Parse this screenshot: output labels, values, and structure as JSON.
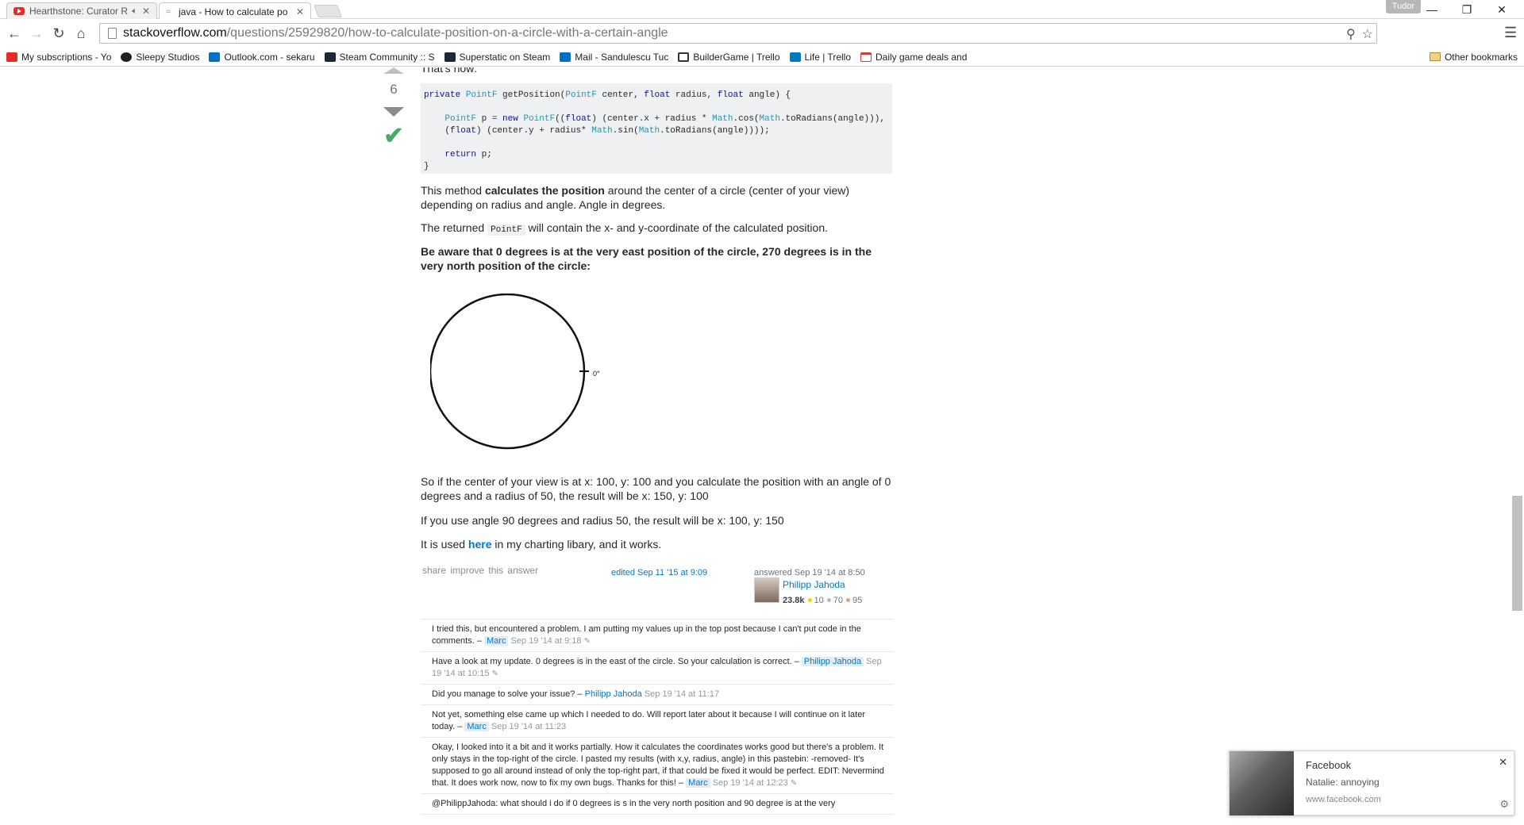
{
  "browser": {
    "tabs": [
      {
        "title": "Hearthstone: Curator R",
        "active": false
      },
      {
        "title": "java - How to calculate po",
        "active": true
      }
    ],
    "profile_name": "Tudor",
    "url_host": "stackoverflow.com",
    "url_path": "/questions/25929820/how-to-calculate-position-on-a-circle-with-a-certain-angle",
    "bookmarks": [
      {
        "label": "My subscriptions - Yo",
        "icon": "youtube-icon",
        "color": "#e52d27"
      },
      {
        "label": "Sleepy Studios",
        "icon": "sleepy-icon",
        "color": "#222222"
      },
      {
        "label": "Outlook.com - sekaru",
        "icon": "outlook-icon",
        "color": "#0072c6"
      },
      {
        "label": "Steam Community :: S",
        "icon": "steam-icon",
        "color": "#1b2838"
      },
      {
        "label": "Superstatic on Steam",
        "icon": "steam-icon",
        "color": "#1b2838"
      },
      {
        "label": "Mail - Sandulescu Tuc",
        "icon": "mail-icon",
        "color": "#0072c6"
      },
      {
        "label": "BuilderGame | Trello",
        "icon": "trello-icon",
        "color": "#0079bf"
      },
      {
        "label": "Life | Trello",
        "icon": "trello-icon",
        "color": "#0079bf"
      },
      {
        "label": "Daily game deals and",
        "icon": "calendar-icon",
        "color": "#d23f31"
      }
    ],
    "other_bookmarks": "Other bookmarks"
  },
  "answer": {
    "cut_text": "That's how:",
    "score": "6",
    "code_lines": [
      "private PointF getPosition(PointF center, float radius, float angle) {",
      "",
      "    PointF p = new PointF((float) (center.x + radius * Math.cos(Math.toRadians(angle))),",
      "    (float) (center.y + radius* Math.sin(Math.toRadians(angle))));",
      "",
      "    return p;",
      "}"
    ],
    "para1_a": "This method ",
    "para1_bold": "calculates the position",
    "para1_b": " around the center of a circle (center of your view) depending on radius and angle. Angle in degrees.",
    "para2_a": "The returned ",
    "para2_code": "PointF",
    "para2_b": " will contain the x- and y-coordinate of the calculated position.",
    "para3": "Be aware that 0 degrees is at the very east position of the circle, 270 degrees is in the very north position of the circle:",
    "circle_label": "0°",
    "para4": "So if the center of your view is at x: 100, y: 100 and you calculate the position with an angle of 0 degrees and a radius of 50, the result will be x: 150, y: 100",
    "para5": "If you use angle 90 degrees and radius 50, the result will be x: 100, y: 150",
    "para6_a": "It is used ",
    "para6_link": "here",
    "para6_b": " in my charting libary, and it works.",
    "menu_share": "share",
    "menu_improve": "improve this answer",
    "edited": "edited Sep 11 '15 at 9:09",
    "answered": "answered Sep 19 '14 at 8:50",
    "user_name": "Philipp Jahoda",
    "user_rep": "23.8k",
    "badge_gold": "10",
    "badge_silver": "70",
    "badge_bronze": "95"
  },
  "comments": [
    {
      "text": "I tried this, but encountered a problem. I am putting my values up in the top post because I can't put code in the comments. – ",
      "user": "Marc",
      "highlight": true,
      "date": "Sep 19 '14 at 9:18",
      "edited": true
    },
    {
      "text": "Have a look at my update. 0 degrees is in the east of the circle. So your calculation is correct. – ",
      "user": "Philipp Jahoda",
      "highlight": true,
      "date": "Sep 19 '14 at 10:15",
      "edited": true
    },
    {
      "text": "Did you manage to solve your issue? – ",
      "user": "Philipp Jahoda",
      "highlight": false,
      "date": "Sep 19 '14 at 11:17",
      "edited": false
    },
    {
      "text": "Not yet, something else came up which I needed to do. Will report later about it because I will continue on it later today. – ",
      "user": "Marc",
      "highlight": true,
      "date": "Sep 19 '14 at 11:23",
      "edited": false
    },
    {
      "text": "Okay, I looked into it a bit and it works partially. How it calculates the coordinates works good but there's a problem. It only stays in the top-right of the circle. I pasted my results (with x,y, radius, angle) in this pastebin: -removed- It's supposed to go all around instead of only the top-right part, if that could be fixed it would be perfect. EDIT: Nevermind that. It does work now, now to fix my own bugs. Thanks for this! – ",
      "user": "Marc",
      "highlight": true,
      "date": "Sep 19 '14 at 12:23",
      "edited": true
    },
    {
      "text": "@PhilippJahoda: what should i do if 0 degrees is s in the very north position and 90 degree is at the very",
      "user": "",
      "highlight": false,
      "date": "",
      "edited": false
    }
  ],
  "notification": {
    "title": "Facebook",
    "body": "Natalie: annoying",
    "site": "www.facebook.com"
  }
}
